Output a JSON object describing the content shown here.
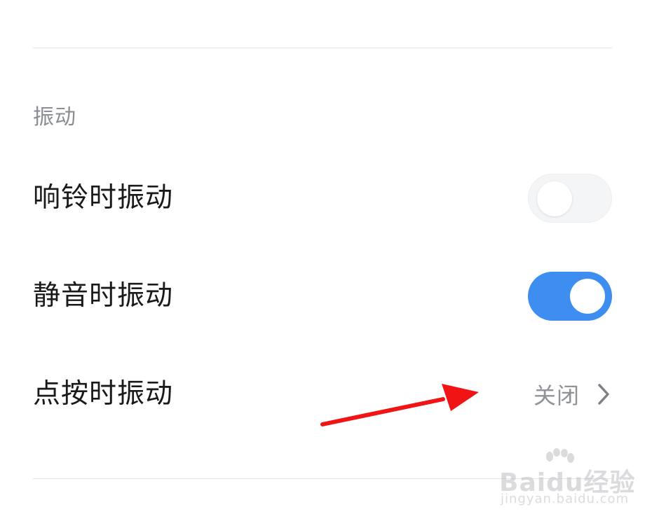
{
  "section": {
    "title": "振动"
  },
  "rows": [
    {
      "label": "响铃时振动",
      "toggle_on": false
    },
    {
      "label": "静音时振动",
      "toggle_on": true
    },
    {
      "label": "点按时振动",
      "value": "关闭"
    }
  ],
  "colors": {
    "accent": "#3d8ef0",
    "toggle_off": "#f4f5f7",
    "annotation_arrow": "#f01414"
  },
  "icons": {
    "chevron": "chevron-right-icon",
    "annotation": "red-arrow-annotation"
  },
  "watermark": {
    "brand_main": "Baidu经验",
    "brand_url": "jingyan.baidu.com"
  }
}
